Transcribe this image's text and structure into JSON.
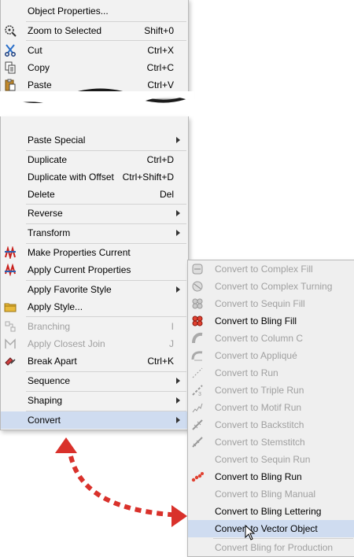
{
  "menu_top": [
    {
      "label": "Object Properties...",
      "shortcut": "",
      "icon": "",
      "disabled": false
    },
    {
      "label": "Zoom to Selected",
      "shortcut": "Shift+0",
      "icon": "zoom-icon",
      "disabled": false
    },
    {
      "label": "Cut",
      "shortcut": "Ctrl+X",
      "icon": "scissors-icon",
      "disabled": false
    },
    {
      "label": "Copy",
      "shortcut": "Ctrl+C",
      "icon": "copy-icon",
      "disabled": false
    },
    {
      "label": "Paste",
      "shortcut": "Ctrl+V",
      "icon": "paste-icon",
      "disabled": false
    }
  ],
  "menu_bottom": [
    {
      "label": "Paste Special",
      "shortcut": "",
      "submenu": true,
      "disabled": false
    },
    {
      "label": "Duplicate",
      "shortcut": "Ctrl+D",
      "disabled": false
    },
    {
      "label": "Duplicate with Offset",
      "shortcut": "Ctrl+Shift+D",
      "disabled": false
    },
    {
      "label": "Delete",
      "shortcut": "Del",
      "disabled": false
    },
    {
      "label": "Reverse",
      "shortcut": "",
      "submenu": true,
      "disabled": false
    },
    {
      "label": "Transform",
      "shortcut": "",
      "submenu": true,
      "disabled": false
    },
    {
      "label": "Make Properties Current",
      "shortcut": "",
      "icon": "make-properties-icon",
      "disabled": false
    },
    {
      "label": "Apply Current Properties",
      "shortcut": "",
      "icon": "apply-properties-icon",
      "disabled": false
    },
    {
      "label": "Apply Favorite Style",
      "shortcut": "",
      "submenu": true,
      "disabled": false
    },
    {
      "label": "Apply Style...",
      "shortcut": "",
      "icon": "folder-icon",
      "disabled": false
    },
    {
      "label": "Branching",
      "shortcut": "I",
      "icon": "branching-icon",
      "disabled": true
    },
    {
      "label": "Apply Closest Join",
      "shortcut": "J",
      "icon": "closest-join-icon",
      "disabled": true
    },
    {
      "label": "Break Apart",
      "shortcut": "Ctrl+K",
      "icon": "break-apart-icon",
      "disabled": false
    },
    {
      "label": "Sequence",
      "shortcut": "",
      "submenu": true,
      "disabled": false
    },
    {
      "label": "Shaping",
      "shortcut": "",
      "submenu": true,
      "disabled": false
    },
    {
      "label": "Convert",
      "shortcut": "",
      "submenu": true,
      "disabled": false,
      "highlighted": true
    }
  ],
  "submenu": [
    {
      "label": "Convert to Complex Fill",
      "icon": "complex-fill-icon",
      "disabled": true
    },
    {
      "label": "Convert to Complex Turning",
      "icon": "complex-turning-icon",
      "disabled": true
    },
    {
      "label": "Convert to Sequin Fill",
      "icon": "sequin-fill-icon",
      "disabled": true
    },
    {
      "label": "Convert to Bling Fill",
      "icon": "bling-fill-icon",
      "disabled": false
    },
    {
      "label": "Convert to Column C",
      "icon": "column-c-icon",
      "disabled": true
    },
    {
      "label": "Convert to Appliqué",
      "icon": "applique-icon",
      "disabled": true
    },
    {
      "label": "Convert to Run",
      "icon": "run-icon",
      "disabled": true
    },
    {
      "label": "Convert to Triple Run",
      "icon": "triple-run-icon",
      "disabled": true
    },
    {
      "label": "Convert to Motif Run",
      "icon": "motif-run-icon",
      "disabled": true
    },
    {
      "label": "Convert to Backstitch",
      "icon": "backstitch-icon",
      "disabled": true
    },
    {
      "label": "Convert to Stemstitch",
      "icon": "stemstitch-icon",
      "disabled": true
    },
    {
      "label": "Convert to Sequin Run",
      "icon": "",
      "disabled": true
    },
    {
      "label": "Convert to Bling Run",
      "icon": "bling-run-icon",
      "disabled": false
    },
    {
      "label": "Convert to Bling Manual",
      "icon": "",
      "disabled": true
    },
    {
      "label": "Convert to Bling Lettering",
      "icon": "",
      "disabled": false
    },
    {
      "label": "Convert to Vector Object",
      "icon": "",
      "disabled": false,
      "highlighted": true
    },
    {
      "label": "Convert Bling for Production",
      "icon": "",
      "disabled": true
    }
  ],
  "colors": {
    "highlight": "#cfdcf0",
    "arrow": "#d9312b",
    "menu_bg": "#f2f2f2",
    "disabled": "#a0a0a0"
  }
}
